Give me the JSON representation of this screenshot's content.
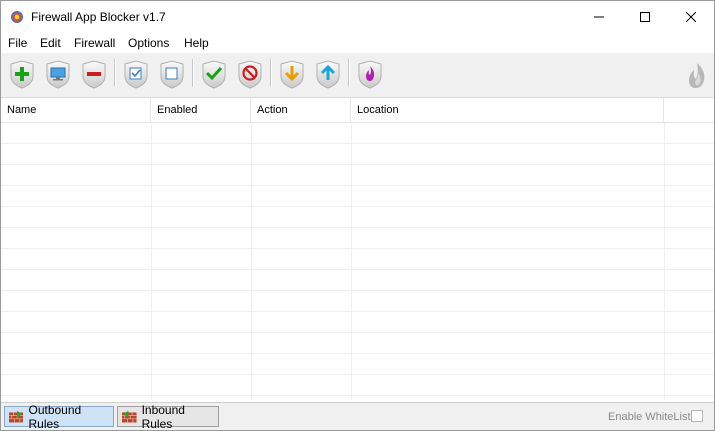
{
  "window": {
    "title": "Firewall App Blocker v1.7"
  },
  "menu": [
    "File",
    "Edit",
    "Firewall",
    "Options",
    "Help"
  ],
  "toolbar": {
    "buttons": [
      {
        "name": "add-program",
        "icon": "green-plus-icon"
      },
      {
        "name": "add-running-process",
        "icon": "monitor-icon"
      },
      {
        "name": "remove-rule",
        "icon": "red-minus-icon"
      },
      {
        "name": "select-all",
        "icon": "checkbox-checked-icon"
      },
      {
        "name": "deselect-all",
        "icon": "checkbox-empty-icon"
      },
      {
        "name": "enable-rule",
        "icon": "green-check-icon"
      },
      {
        "name": "disable-rule",
        "icon": "block-icon"
      },
      {
        "name": "import-rules",
        "icon": "arrow-down-icon"
      },
      {
        "name": "export-rules",
        "icon": "arrow-up-icon"
      },
      {
        "name": "firewall-state",
        "icon": "flame-icon"
      }
    ]
  },
  "list": {
    "columns": [
      "Name",
      "Enabled",
      "Action",
      "Location"
    ],
    "rows": []
  },
  "statusbar": {
    "tabs": [
      {
        "label": "Outbound Rules",
        "active": true
      },
      {
        "label": "Inbound Rules",
        "active": false
      }
    ],
    "whitelist_label": "Enable WhiteList",
    "whitelist_checked": false
  },
  "colors": {
    "accent_active_tab": "#cfe3f7",
    "toolbar_bg": "#f0f0f0",
    "grid_line": "#efefef"
  }
}
